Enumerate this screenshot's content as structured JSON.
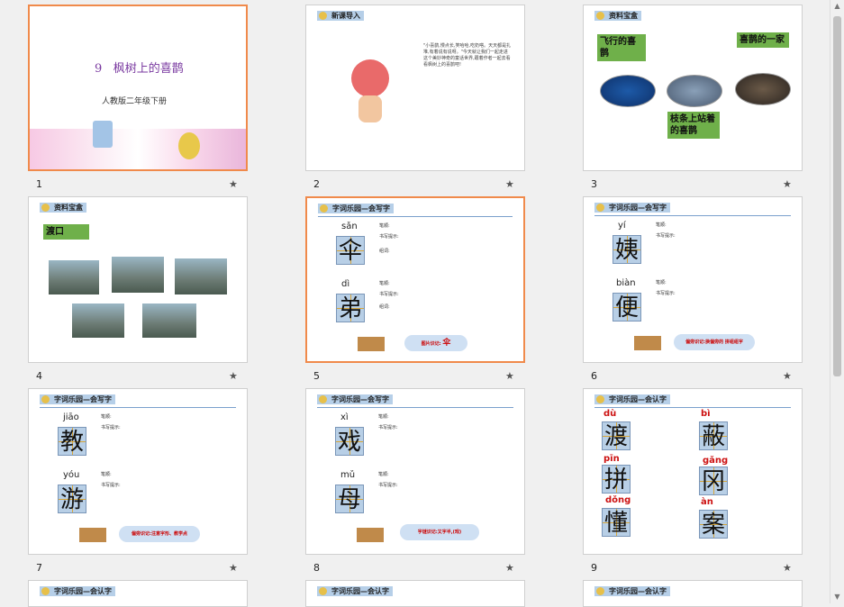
{
  "slides": [
    {
      "num": "1",
      "title_num": "9",
      "title": "枫树上的喜鹊",
      "subtitle": "人教版二年级下册"
    },
    {
      "num": "2",
      "banner": "新课导入",
      "text": "\"小喜鹊,慢点长,笑哈哈,吃奶嗒。天天都是扎堆,有着说有说呀。\"今天就让我们一起走进这个美妙神奇的童话世界,跟着作者一起去看看枫树上的喜鹊吧!"
    },
    {
      "num": "3",
      "banner": "资料宝盒",
      "labels": [
        "飞行的喜鹊",
        "喜鹊的一家",
        "枝条上站着的喜鹊"
      ]
    },
    {
      "num": "4",
      "banner": "资料宝盒",
      "label": "渡口"
    },
    {
      "num": "5",
      "banner": "字词乐园—会写字",
      "chars": [
        {
          "pinyin": "sǎn",
          "char": "伞"
        },
        {
          "pinyin": "dì",
          "char": "弟"
        }
      ],
      "note": "图片识记:",
      "note_char": "伞"
    },
    {
      "num": "6",
      "banner": "字词乐园—会写字",
      "chars": [
        {
          "pinyin": "yí",
          "char": "姨"
        },
        {
          "pinyin": "biàn",
          "char": "便"
        }
      ],
      "note": "偏旁识记:换偏旁的 拼组组字"
    },
    {
      "num": "7",
      "banner": "字词乐园—会写字",
      "chars": [
        {
          "pinyin": "jiāo",
          "char": "教"
        },
        {
          "pinyin": "yóu",
          "char": "游"
        }
      ],
      "note": "偏旁识记:注意字形、教学点"
    },
    {
      "num": "8",
      "banner": "字词乐园—会写字",
      "chars": [
        {
          "pinyin": "xì",
          "char": "戏"
        },
        {
          "pinyin": "mǔ",
          "char": "母"
        }
      ],
      "note": "字谜识记:又字半,(戏)"
    },
    {
      "num": "9",
      "banner": "字词乐园—会认字",
      "chars": [
        {
          "pinyin": "dù",
          "char": "渡"
        },
        {
          "pinyin": "bì",
          "char": "蔽"
        },
        {
          "pinyin": "pīn",
          "char": "拼"
        },
        {
          "pinyin": "gǎng",
          "char": "冈"
        },
        {
          "pinyin": "dǒng",
          "char": "懂"
        },
        {
          "pinyin": "àn",
          "char": "案"
        }
      ]
    },
    {
      "num": "",
      "banner": "字词乐园—会认字"
    },
    {
      "num": "",
      "banner": "字词乐园—会认字"
    },
    {
      "num": "",
      "banner": "字词乐园—会认字"
    }
  ],
  "detail_labels": {
    "strokes": "笔顺:",
    "tip": "书写提示:",
    "words": "组词:",
    "phrase": "造句:",
    "sentence": "造句:"
  },
  "colors": {
    "selected": "#f08a4b",
    "banner": "#b6cfe8",
    "charbox": "#b8cfe6",
    "green": "#6fb04a"
  }
}
